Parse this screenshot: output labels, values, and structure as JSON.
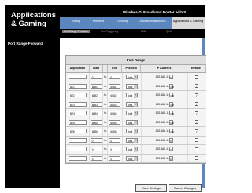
{
  "header": {
    "section_title": "Applications & Gaming",
    "device_name": "Wireless-G Broadband Router with S"
  },
  "nav": {
    "tabs": [
      "Setup",
      "Wireless",
      "Security",
      "Access Restrictions",
      "Applications & Gaming"
    ]
  },
  "subnav": {
    "tabs": [
      "Port Range Forward",
      "Port Triggering",
      "DMZ",
      "QoS"
    ]
  },
  "sidebar": {
    "label": "Port Range Forward"
  },
  "table": {
    "title": "Port Range",
    "columns": [
      "Application",
      "Start",
      "",
      "End",
      "Protocol",
      "IP Address",
      "Enable"
    ],
    "ip_prefix": "192.168.1.",
    "rows": [
      {
        "app": "",
        "start": "0",
        "to": "to",
        "end": "0",
        "proto": "Both",
        "ip": "0",
        "enabled": false
      },
      {
        "app": "BT1",
        "start": "6881",
        "to": "to",
        "end": "6881",
        "proto": "Both",
        "ip": "100",
        "enabled": true
      },
      {
        "app": "BT2",
        "start": "6882",
        "to": "to",
        "end": "6882",
        "proto": "Both",
        "ip": "100",
        "enabled": true
      },
      {
        "app": "BT3",
        "start": "6883",
        "to": "to",
        "end": "6883",
        "proto": "Both",
        "ip": "100",
        "enabled": true
      },
      {
        "app": "BT4",
        "start": "6884",
        "to": "to",
        "end": "6884",
        "proto": "Both",
        "ip": "100",
        "enabled": true
      },
      {
        "app": "BT5",
        "start": "6885",
        "to": "to",
        "end": "6885",
        "proto": "Both",
        "ip": "100",
        "enabled": true
      },
      {
        "app": "BT6",
        "start": "6886",
        "to": "to",
        "end": "6886",
        "proto": "Both",
        "ip": "100",
        "enabled": true
      },
      {
        "app": "",
        "start": "0",
        "to": "to",
        "end": "0",
        "proto": "Both",
        "ip": "0",
        "enabled": false
      },
      {
        "app": "",
        "start": "0",
        "to": "to",
        "end": "0",
        "proto": "Both",
        "ip": "0",
        "enabled": false
      },
      {
        "app": "",
        "start": "0",
        "to": "to",
        "end": "0",
        "proto": "Both",
        "ip": "0",
        "enabled": false
      }
    ]
  },
  "buttons": {
    "save": "Save Settings",
    "cancel": "Cancel Changes"
  },
  "colors": {
    "nav_blue": "#5b86be",
    "header_black": "#000000"
  }
}
